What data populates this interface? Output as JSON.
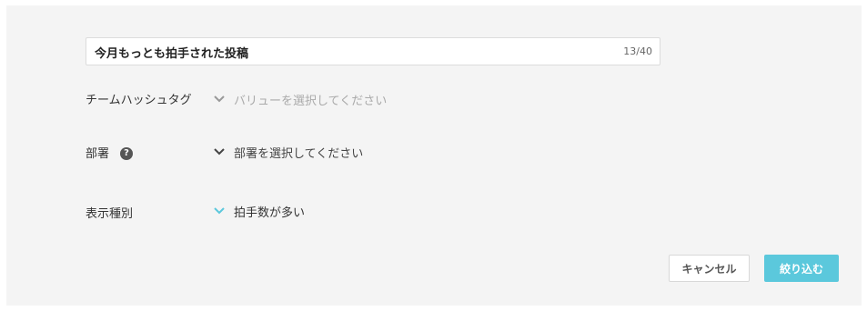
{
  "title_field": {
    "value": "今月もっとも拍手された投稿",
    "char_count": "13/40"
  },
  "filters": {
    "hashtag": {
      "label": "チームハッシュタグ",
      "placeholder": "バリューを選択してください"
    },
    "department": {
      "label": "部署",
      "help_icon_glyph": "?",
      "placeholder": "部署を選択してください"
    },
    "display_type": {
      "label": "表示種別",
      "value": "拍手数が多い"
    }
  },
  "actions": {
    "cancel_label": "キャンセル",
    "apply_label": "絞り込む"
  },
  "colors": {
    "accent": "#5bc8dc",
    "panel_bg": "#f4f4f4",
    "chevron_muted": "#999999",
    "chevron_dark": "#444444"
  }
}
